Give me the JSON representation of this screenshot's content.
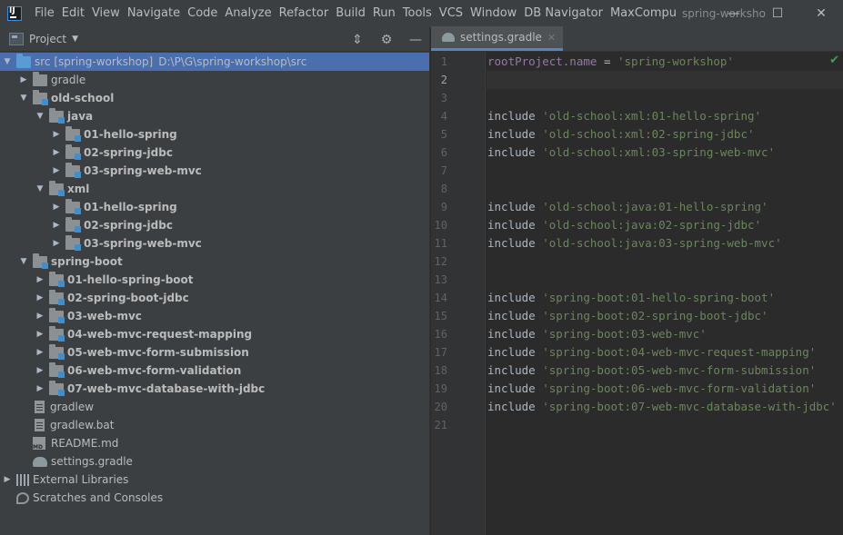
{
  "menu": {
    "items": [
      {
        "label": "File"
      },
      {
        "label": "Edit"
      },
      {
        "label": "View"
      },
      {
        "label": "Navigate"
      },
      {
        "label": "Code"
      },
      {
        "label": "Analyze"
      },
      {
        "label": "Refactor"
      },
      {
        "label": "Build"
      },
      {
        "label": "Run"
      },
      {
        "label": "Tools"
      },
      {
        "label": "VCS"
      },
      {
        "label": "Window"
      },
      {
        "label": "DB Navigator"
      },
      {
        "label": "MaxCompu"
      }
    ],
    "window_title": "spring-worksho"
  },
  "window_controls": {
    "minimize": "—",
    "maximize": "☐",
    "close": "✕"
  },
  "project_panel": {
    "title": "Project",
    "dropdown": "▼"
  },
  "tree": [
    {
      "label": "src [spring-workshop]",
      "path": "D:\\P\\G\\spring-workshop\\src"
    },
    {
      "label": "gradle"
    },
    {
      "label": "old-school"
    },
    {
      "label": "java"
    },
    {
      "label": "01-hello-spring"
    },
    {
      "label": "02-spring-jdbc"
    },
    {
      "label": "03-spring-web-mvc"
    },
    {
      "label": "xml"
    },
    {
      "label": "01-hello-spring"
    },
    {
      "label": "02-spring-jdbc"
    },
    {
      "label": "03-spring-web-mvc"
    },
    {
      "label": "spring-boot"
    },
    {
      "label": "01-hello-spring-boot"
    },
    {
      "label": "02-spring-boot-jdbc"
    },
    {
      "label": "03-web-mvc"
    },
    {
      "label": "04-web-mvc-request-mapping"
    },
    {
      "label": "05-web-mvc-form-submission"
    },
    {
      "label": "06-web-mvc-form-validation"
    },
    {
      "label": "07-web-mvc-database-with-jdbc"
    },
    {
      "label": "gradlew"
    },
    {
      "label": "gradlew.bat"
    },
    {
      "label": "README.md"
    },
    {
      "label": "settings.gradle"
    },
    {
      "label": "External Libraries"
    },
    {
      "label": "Scratches and Consoles"
    }
  ],
  "editor": {
    "tab_label": "settings.gradle",
    "line_numbers": [
      "1",
      "2",
      "3",
      "4",
      "5",
      "6",
      "7",
      "8",
      "9",
      "10",
      "11",
      "12",
      "13",
      "14",
      "15",
      "16",
      "17",
      "18",
      "19",
      "20",
      "21"
    ],
    "lines": [
      {
        "ident": "rootProject.name",
        "kw": " = ",
        "str": "'spring-workshop'"
      },
      {
        "ident": "",
        "kw": "",
        "str": ""
      },
      {
        "ident": "",
        "kw": "",
        "str": ""
      },
      {
        "ident": "",
        "kw": "include ",
        "str": "'old-school:xml:01-hello-spring'"
      },
      {
        "ident": "",
        "kw": "include ",
        "str": "'old-school:xml:02-spring-jdbc'"
      },
      {
        "ident": "",
        "kw": "include ",
        "str": "'old-school:xml:03-spring-web-mvc'"
      },
      {
        "ident": "",
        "kw": "",
        "str": ""
      },
      {
        "ident": "",
        "kw": "",
        "str": ""
      },
      {
        "ident": "",
        "kw": "include ",
        "str": "'old-school:java:01-hello-spring'"
      },
      {
        "ident": "",
        "kw": "include ",
        "str": "'old-school:java:02-spring-jdbc'"
      },
      {
        "ident": "",
        "kw": "include ",
        "str": "'old-school:java:03-spring-web-mvc'"
      },
      {
        "ident": "",
        "kw": "",
        "str": ""
      },
      {
        "ident": "",
        "kw": "",
        "str": ""
      },
      {
        "ident": "",
        "kw": "include ",
        "str": "'spring-boot:01-hello-spring-boot'"
      },
      {
        "ident": "",
        "kw": "include ",
        "str": "'spring-boot:02-spring-boot-jdbc'"
      },
      {
        "ident": "",
        "kw": "include ",
        "str": "'spring-boot:03-web-mvc'"
      },
      {
        "ident": "",
        "kw": "include ",
        "str": "'spring-boot:04-web-mvc-request-mapping'"
      },
      {
        "ident": "",
        "kw": "include ",
        "str": "'spring-boot:05-web-mvc-form-submission'"
      },
      {
        "ident": "",
        "kw": "include ",
        "str": "'spring-boot:06-web-mvc-form-validation'"
      },
      {
        "ident": "",
        "kw": "include ",
        "str": "'spring-boot:07-web-mvc-database-with-jdbc'"
      },
      {
        "ident": "",
        "kw": "",
        "str": ""
      }
    ],
    "current_line": "2"
  }
}
